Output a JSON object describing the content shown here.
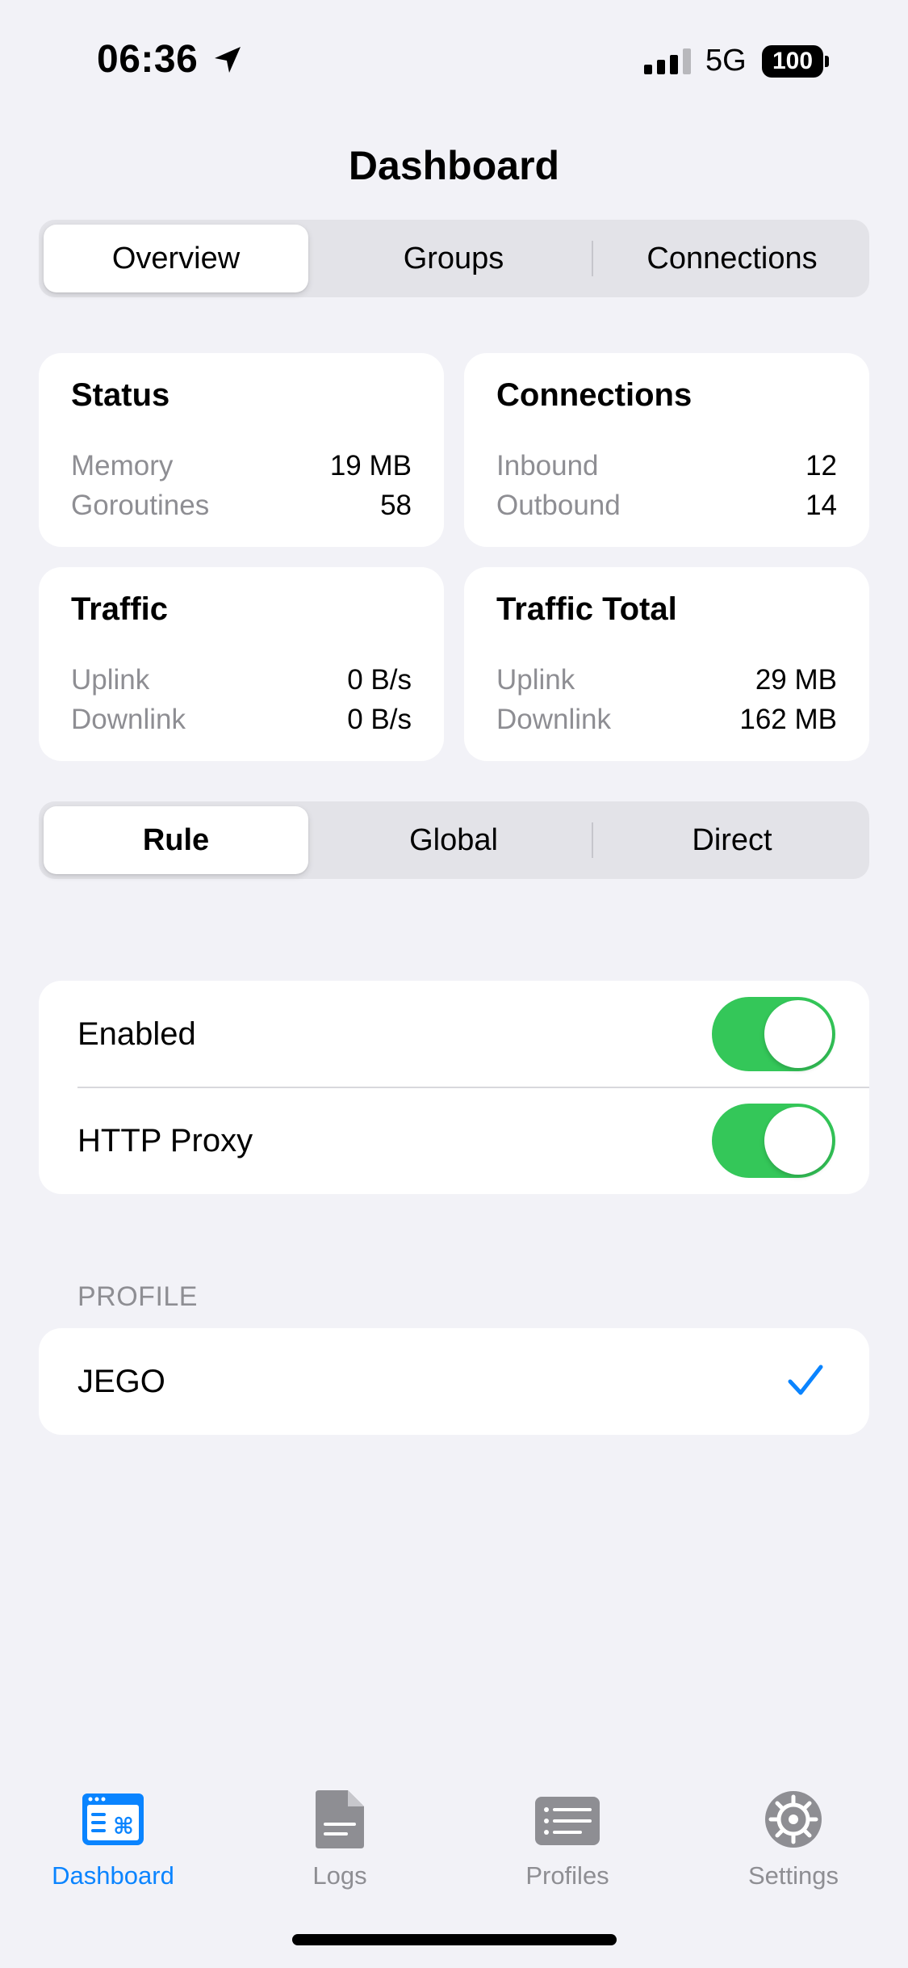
{
  "status_bar": {
    "time": "06:36",
    "network": "5G",
    "battery": "100",
    "location_icon": "location-arrow-icon",
    "signal_icon": "cellular-signal-icon"
  },
  "nav": {
    "title": "Dashboard"
  },
  "view_tabs": {
    "items": [
      "Overview",
      "Groups",
      "Connections"
    ],
    "selected": "Overview"
  },
  "cards": {
    "status": {
      "title": "Status",
      "rows": [
        {
          "key": "Memory",
          "value": "19 MB"
        },
        {
          "key": "Goroutines",
          "value": "58"
        }
      ]
    },
    "connections": {
      "title": "Connections",
      "rows": [
        {
          "key": "Inbound",
          "value": "12"
        },
        {
          "key": "Outbound",
          "value": "14"
        }
      ]
    },
    "traffic": {
      "title": "Traffic",
      "rows": [
        {
          "key": "Uplink",
          "value": "0 B/s"
        },
        {
          "key": "Downlink",
          "value": "0 B/s"
        }
      ]
    },
    "traffic_total": {
      "title": "Traffic Total",
      "rows": [
        {
          "key": "Uplink",
          "value": "29 MB"
        },
        {
          "key": "Downlink",
          "value": "162 MB"
        }
      ]
    }
  },
  "mode": {
    "items": [
      "Rule",
      "Global",
      "Direct"
    ],
    "selected": "Rule"
  },
  "switches": [
    {
      "label": "Enabled",
      "on": true
    },
    {
      "label": "HTTP Proxy",
      "on": true
    }
  ],
  "profile": {
    "header": "PROFILE",
    "items": [
      {
        "name": "JEGO",
        "selected": true
      }
    ]
  },
  "tab_bar": {
    "items": [
      {
        "label": "Dashboard",
        "icon": "dashboard-icon",
        "active": true
      },
      {
        "label": "Logs",
        "icon": "document-icon",
        "active": false
      },
      {
        "label": "Profiles",
        "icon": "list-icon",
        "active": false
      },
      {
        "label": "Settings",
        "icon": "gear-icon",
        "active": false
      }
    ]
  },
  "colors": {
    "accent": "#0a84ff",
    "toggle_on": "#34c759",
    "background": "#f2f2f7",
    "secondary_text": "#8e8e93"
  }
}
